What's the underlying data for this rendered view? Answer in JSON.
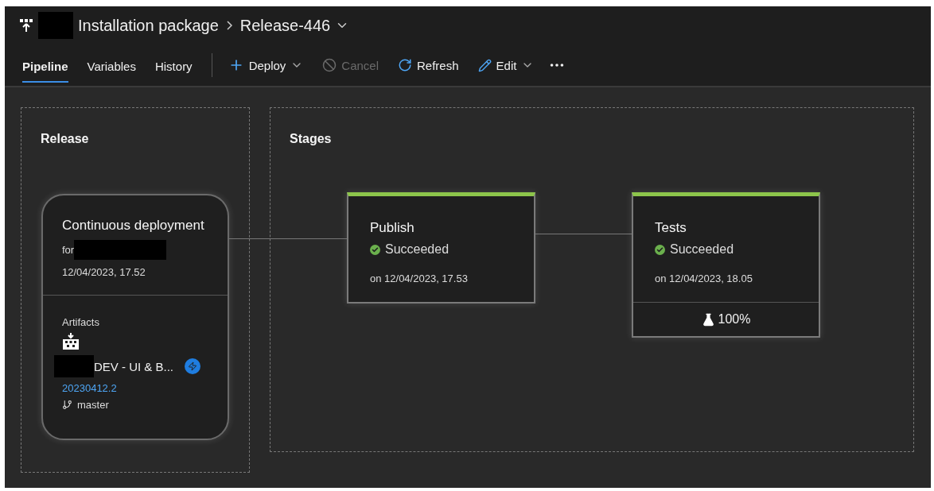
{
  "header": {
    "breadcrumb": [
      "Installation package",
      "Release-446"
    ]
  },
  "tabs": [
    {
      "label": "Pipeline",
      "selected": true
    },
    {
      "label": "Variables",
      "selected": false
    },
    {
      "label": "History",
      "selected": false
    }
  ],
  "toolbar": [
    {
      "kind": "deploy",
      "label": "Deploy",
      "disabled": false,
      "dropdown": true
    },
    {
      "kind": "cancel",
      "label": "Cancel",
      "disabled": true,
      "dropdown": false
    },
    {
      "kind": "refresh",
      "label": "Refresh",
      "disabled": false,
      "dropdown": false
    },
    {
      "kind": "edit",
      "label": "Edit",
      "disabled": false,
      "dropdown": true
    },
    {
      "kind": "more"
    }
  ],
  "release": {
    "title": "Release",
    "trigger": {
      "title": "Continuous deployment",
      "for_label": "for",
      "date": "12/04/2023, 17.52"
    },
    "artifacts": {
      "title": "Artifacts",
      "name": "DEV - UI & B...",
      "version": "20230412.2",
      "branch": "master"
    }
  },
  "stages": {
    "title": "Stages",
    "items": [
      {
        "name": "Publish",
        "kind": "succeeded",
        "status_label": "Succeeded",
        "time": "on 12/04/2023, 17.53"
      },
      {
        "name": "Tests",
        "kind": "succeeded",
        "status_label": "Succeeded",
        "time": "on 12/04/2023, 18.05",
        "tests": "100%"
      }
    ]
  }
}
